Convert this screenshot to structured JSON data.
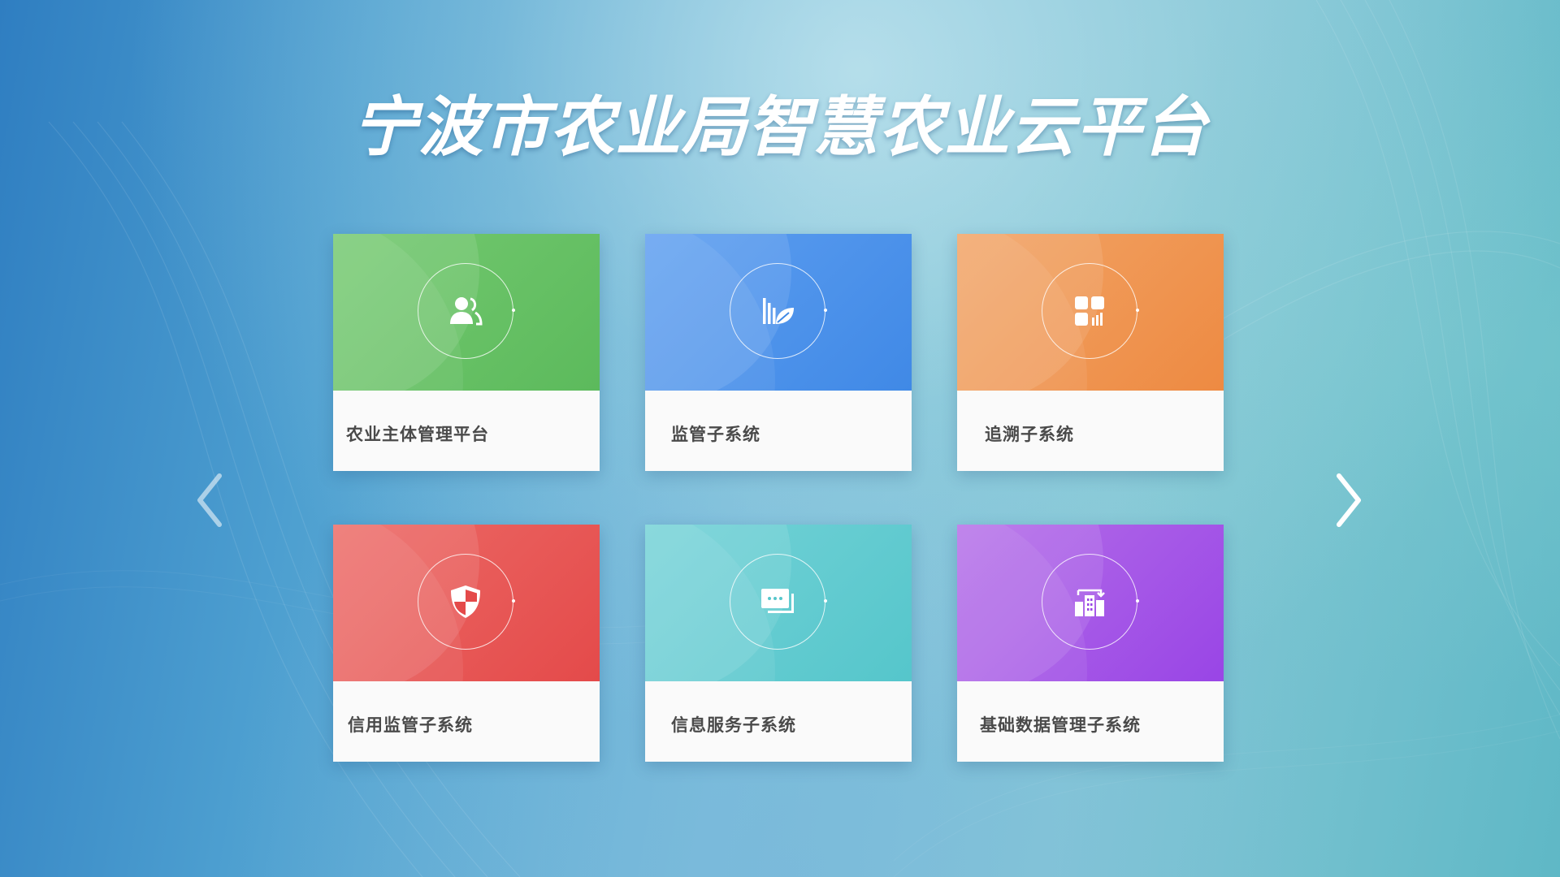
{
  "header": {
    "title": "宁波市农业局智慧农业云平台"
  },
  "cards": [
    {
      "label": "农业主体管理平台",
      "icon": "users-icon",
      "color": "#5cba5c"
    },
    {
      "label": "监管子系统",
      "icon": "chart-leaf-icon",
      "color": "#4089e6"
    },
    {
      "label": "追溯子系统",
      "icon": "dashboard-grid-icon",
      "color": "#ee8a42"
    },
    {
      "label": "信用监管子系统",
      "icon": "shield-icon",
      "color": "#e44a4a"
    },
    {
      "label": "信息服务子系统",
      "icon": "message-icon",
      "color": "#55c6cb"
    },
    {
      "label": "基础数据管理子系统",
      "icon": "data-building-icon",
      "color": "#9945e6"
    }
  ],
  "navigation": {
    "prev_icon": "chevron-left-icon",
    "next_icon": "chevron-right-icon"
  }
}
